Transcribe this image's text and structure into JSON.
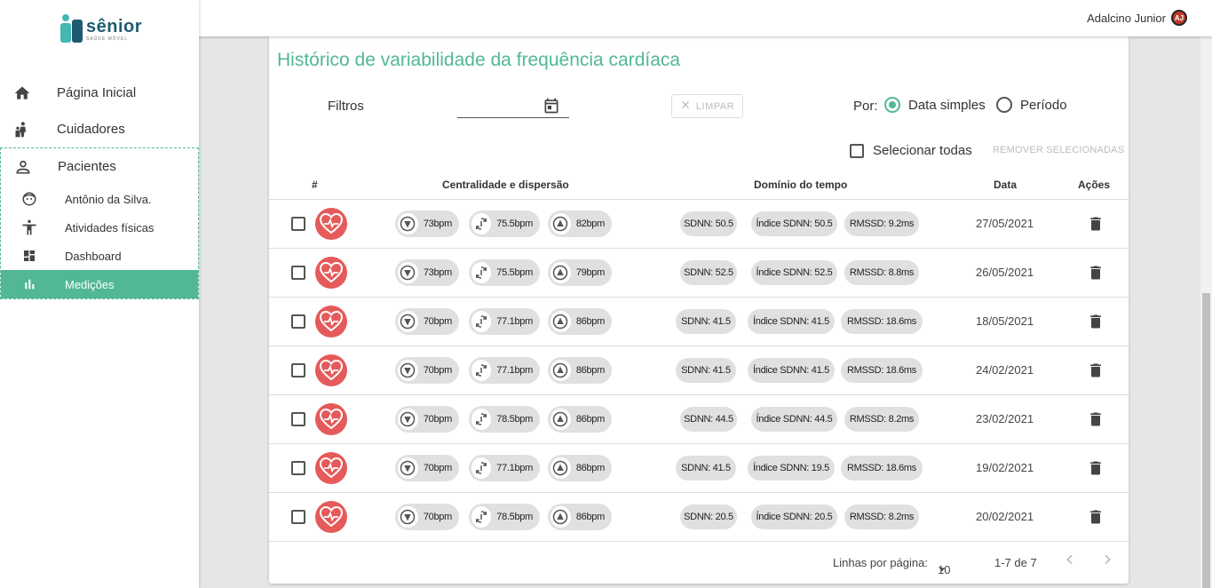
{
  "user": {
    "name": "Adalcino Junior",
    "initials": "AJ"
  },
  "logo": {
    "name": "sênior",
    "tagline": "SAÚDE MÓVEL"
  },
  "sidebar": {
    "items": [
      {
        "label": "Página Inicial",
        "icon": "home-icon"
      },
      {
        "label": "Cuidadores",
        "icon": "caregivers-icon"
      },
      {
        "label": "Pacientes",
        "icon": "person-icon"
      }
    ],
    "subitems": [
      {
        "label": "Antônio da Silva.",
        "icon": "face-icon"
      },
      {
        "label": "Atividades físicas",
        "icon": "accessibility-icon"
      },
      {
        "label": "Dashboard",
        "icon": "dashboard-icon"
      },
      {
        "label": "Medições",
        "icon": "bar-chart-icon",
        "active": true
      }
    ]
  },
  "page": {
    "title": "Histórico de variabilidade da frequência cardíaca"
  },
  "filters": {
    "label": "Filtros",
    "date_value": "",
    "clear_label": "LIMPAR",
    "por_label": "Por:",
    "radio_simple": "Data simples",
    "radio_period": "Período",
    "selected": "simple",
    "select_all": "Selecionar todas",
    "remove_selected": "REMOVER SELECIONADAS"
  },
  "table": {
    "headers": [
      "#",
      "Centralidade e dispersão",
      "Domínio do tempo",
      "Data",
      "Ações"
    ],
    "rows": [
      {
        "min": "73bpm",
        "avg": "75.5bpm",
        "max": "82bpm",
        "sdnn": "SDNN: 50.5",
        "idx": "Índice SDNN: 50.5",
        "rmssd": "RMSSD: 9.2ms",
        "date": "27/05/2021"
      },
      {
        "min": "73bpm",
        "avg": "75.5bpm",
        "max": "79bpm",
        "sdnn": "SDNN: 52.5",
        "idx": "Índice SDNN: 52.5",
        "rmssd": "RMSSD: 8.8ms",
        "date": "26/05/2021"
      },
      {
        "min": "70bpm",
        "avg": "77.1bpm",
        "max": "86bpm",
        "sdnn": "SDNN: 41.5",
        "idx": "Índice SDNN: 41.5",
        "rmssd": "RMSSD: 18.6ms",
        "date": "18/05/2021"
      },
      {
        "min": "70bpm",
        "avg": "77.1bpm",
        "max": "86bpm",
        "sdnn": "SDNN: 41.5",
        "idx": "Índice SDNN: 41.5",
        "rmssd": "RMSSD: 18.6ms",
        "date": "24/02/2021"
      },
      {
        "min": "70bpm",
        "avg": "78.5bpm",
        "max": "86bpm",
        "sdnn": "SDNN: 44.5",
        "idx": "Índice SDNN: 44.5",
        "rmssd": "RMSSD: 8.2ms",
        "date": "23/02/2021"
      },
      {
        "min": "70bpm",
        "avg": "77.1bpm",
        "max": "86bpm",
        "sdnn": "SDNN: 41.5",
        "idx": "Índice SDNN: 19.5",
        "rmssd": "RMSSD: 18.6ms",
        "date": "19/02/2021"
      },
      {
        "min": "70bpm",
        "avg": "78.5bpm",
        "max": "86bpm",
        "sdnn": "SDNN: 20.5",
        "idx": "Índice SDNN: 20.5",
        "rmssd": "RMSSD: 8.2ms",
        "date": "20/02/2021"
      }
    ]
  },
  "pagination": {
    "rows_per_page_label": "Linhas por página:",
    "rows_per_page": "10",
    "range": "1-7 de 7"
  },
  "colors": {
    "accent": "#52b893",
    "heart": "#e55a5a",
    "brand_dark": "#1e5b73"
  }
}
